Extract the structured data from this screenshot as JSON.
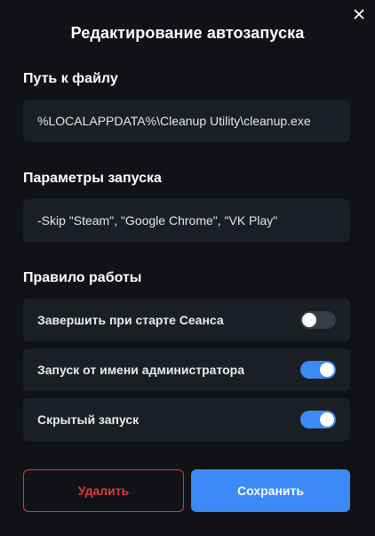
{
  "dialog": {
    "title": "Редактирование автозапуска",
    "close_icon": "close-icon"
  },
  "file_path": {
    "label": "Путь к файлу",
    "value": "%LOCALAPPDATA%\\Cleanup Utility\\cleanup.exe"
  },
  "launch_params": {
    "label": "Параметры запуска",
    "value": "-Skip \"Steam\", \"Google Chrome\", \"VK Play\""
  },
  "rules": {
    "label": "Правило работы",
    "items": [
      {
        "label": "Завершить при старте Сеанса",
        "enabled": false
      },
      {
        "label": "Запуск от имени администратора",
        "enabled": true
      },
      {
        "label": "Скрытый запуск",
        "enabled": true
      }
    ]
  },
  "buttons": {
    "delete_label": "Удалить",
    "save_label": "Сохранить"
  },
  "colors": {
    "background": "#111216",
    "field": "#1c1e25",
    "accent": "#3b8af5",
    "danger": "#e0393e"
  }
}
